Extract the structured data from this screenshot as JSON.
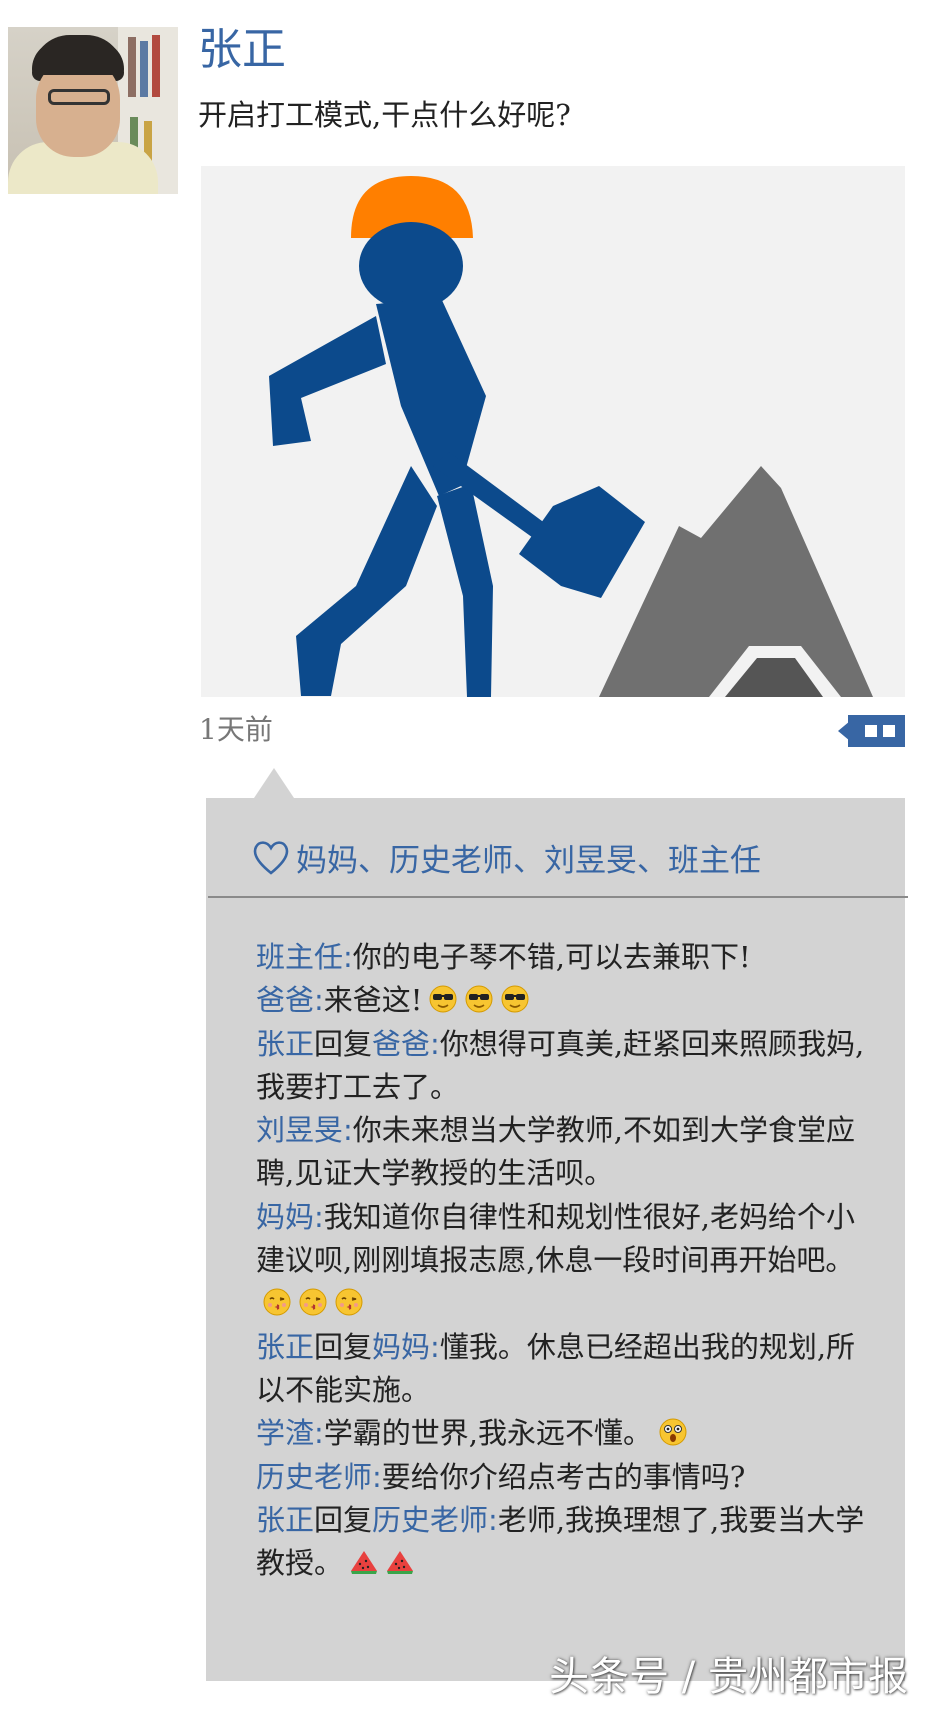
{
  "post": {
    "author": "张正",
    "text": "开启打工模式,干点什么好呢?",
    "time": "1天前"
  },
  "likes": {
    "names": "妈妈、历史老师、刘昱旻、班主任"
  },
  "comments": [
    {
      "author": "班主任",
      "reply_to": "",
      "text": "你的电子琴不错,可以去兼职下!",
      "emojis": []
    },
    {
      "author": "爸爸",
      "reply_to": "",
      "text": "来爸这!",
      "emojis": [
        "cool-face-icon",
        "cool-face-icon",
        "cool-face-icon"
      ]
    },
    {
      "author": "张正",
      "reply_to": "爸爸",
      "text": "你想得可真美,赶紧回来照顾我妈,我要打工去了。",
      "emojis": []
    },
    {
      "author": "刘昱旻",
      "reply_to": "",
      "text": "你未来想当大学教师,不如到大学食堂应聘,见证大学教授的生活呗。",
      "emojis": []
    },
    {
      "author": "妈妈",
      "reply_to": "",
      "text": "我知道你自律性和规划性很好,老妈给个小建议呗,刚刚填报志愿,休息一段时间再开始吧。",
      "emojis": [
        "kiss-face-icon",
        "kiss-face-icon",
        "kiss-face-icon"
      ]
    },
    {
      "author": "张正",
      "reply_to": "妈妈",
      "text": "懂我。休息已经超出我的规划,所以不能实施。",
      "emojis": []
    },
    {
      "author": "学渣",
      "reply_to": "",
      "text": "学霸的世界,我永远不懂。",
      "emojis": [
        "shocked-face-icon"
      ]
    },
    {
      "author": "历史老师",
      "reply_to": "",
      "text": "要给你介绍点考古的事情吗?",
      "emojis": []
    },
    {
      "author": "张正",
      "reply_to": "历史老师",
      "text": "老师,我换理想了,我要当大学教授。",
      "emojis": [
        "watermelon-icon",
        "watermelon-icon"
      ]
    }
  ],
  "labels": {
    "reply_word": "回复",
    "colon": ":"
  },
  "watermark": "头条号 / 贵州都市报",
  "colors": {
    "name_blue": "#3866a4",
    "comment_bg": "#d3d3d3",
    "figure_blue": "#0c4a8c",
    "helmet_orange": "#ff7f00",
    "mountain_gray": "#707070"
  }
}
